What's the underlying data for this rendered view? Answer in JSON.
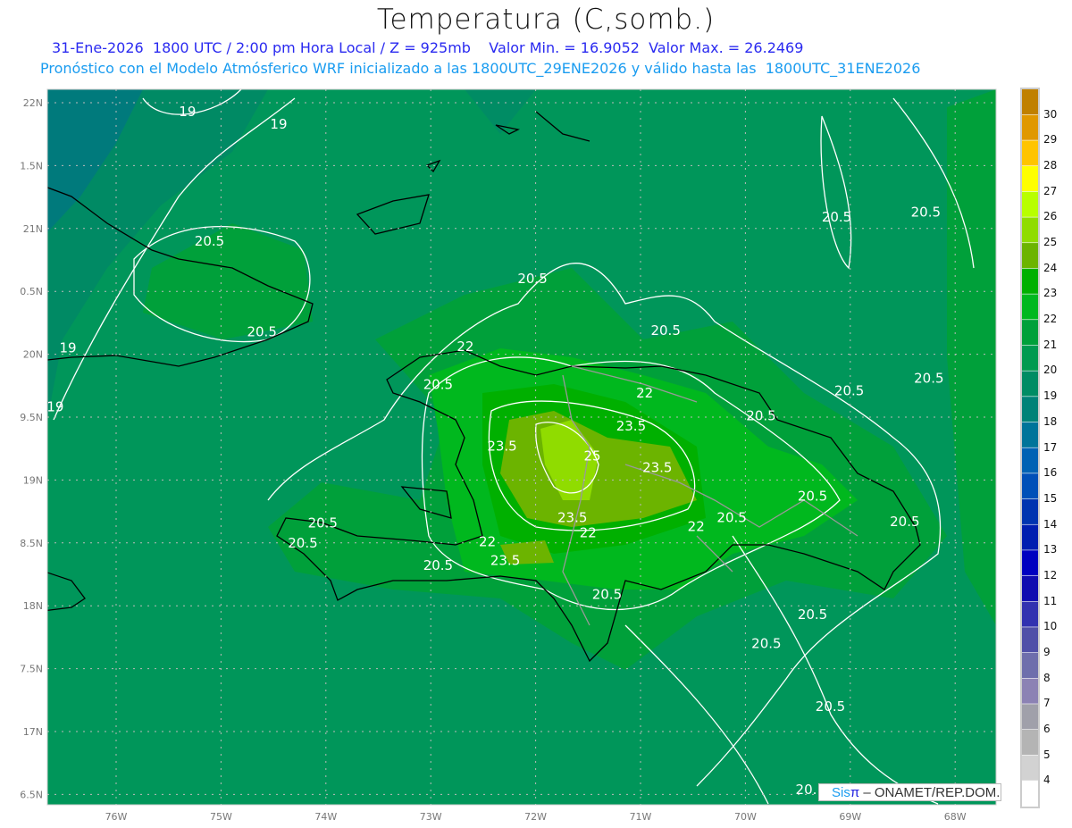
{
  "header": {
    "title": "Temperatura (C,somb.)",
    "subtitle_1": "31-Ene-2026  1800 UTC / 2:00 pm Hora Local / Z = 925mb    Valor Min. = 16.9052  Valor Max. = 26.2469",
    "subtitle_2": "Pronóstico con el Modelo Atmósferico WRF inicializado a las 1800UTC_29ENE2026 y válido hasta las  1800UTC_31ENE2026"
  },
  "map": {
    "projection": "lat-lon",
    "lon_range": [
      -76.65,
      -67.6
    ],
    "lat_range": [
      16.4,
      22.1
    ],
    "lon_ticks": [
      "76W",
      "75W",
      "74W",
      "73W",
      "72W",
      "71W",
      "70W",
      "69W",
      "68W"
    ],
    "lat_ticks": [
      "22N",
      "1.5N",
      "21N",
      "0.5N",
      "20N",
      "9.5N",
      "19N",
      "8.5N",
      "18N",
      "7.5N",
      "17N",
      "6.5N"
    ],
    "grid": "dashed",
    "contour_color": "#ffffff",
    "coastline_color": "#000000",
    "border_color": "#999999",
    "contour_labels": [
      {
        "text": "19",
        "lon": -75.32,
        "lat": 21.93
      },
      {
        "text": "19",
        "lon": -74.45,
        "lat": 21.83
      },
      {
        "text": "20.5",
        "lon": -75.11,
        "lat": 20.9
      },
      {
        "text": "20.5",
        "lon": -72.03,
        "lat": 20.6
      },
      {
        "text": "20.5",
        "lon": -74.61,
        "lat": 20.18
      },
      {
        "text": "19",
        "lon": -76.46,
        "lat": 20.05
      },
      {
        "text": "19",
        "lon": -76.58,
        "lat": 19.58
      },
      {
        "text": "22",
        "lon": -72.67,
        "lat": 20.06
      },
      {
        "text": "20.5",
        "lon": -72.93,
        "lat": 19.76
      },
      {
        "text": "22",
        "lon": -70.96,
        "lat": 19.69
      },
      {
        "text": "23.5",
        "lon": -71.09,
        "lat": 19.43
      },
      {
        "text": "20.5",
        "lon": -70.76,
        "lat": 20.19
      },
      {
        "text": "20.5",
        "lon": -69.01,
        "lat": 19.71
      },
      {
        "text": "20.5",
        "lon": -68.25,
        "lat": 19.81
      },
      {
        "text": "20.5",
        "lon": -68.28,
        "lat": 21.13
      },
      {
        "text": "20.5",
        "lon": -69.13,
        "lat": 21.09
      },
      {
        "text": "20.5",
        "lon": -69.85,
        "lat": 19.51
      },
      {
        "text": "23.5",
        "lon": -72.32,
        "lat": 19.27
      },
      {
        "text": "25",
        "lon": -71.46,
        "lat": 19.19
      },
      {
        "text": "23.5",
        "lon": -70.84,
        "lat": 19.1
      },
      {
        "text": "20.5",
        "lon": -69.36,
        "lat": 18.87
      },
      {
        "text": "20.5",
        "lon": -68.48,
        "lat": 18.67
      },
      {
        "text": "20.5",
        "lon": -74.03,
        "lat": 18.66
      },
      {
        "text": "20.5",
        "lon": -74.22,
        "lat": 18.5
      },
      {
        "text": "23.5",
        "lon": -71.65,
        "lat": 18.7
      },
      {
        "text": "22",
        "lon": -71.5,
        "lat": 18.58
      },
      {
        "text": "22",
        "lon": -70.47,
        "lat": 18.63
      },
      {
        "text": "20.5",
        "lon": -70.13,
        "lat": 18.7
      },
      {
        "text": "22",
        "lon": -72.46,
        "lat": 18.51
      },
      {
        "text": "23.5",
        "lon": -72.29,
        "lat": 18.36
      },
      {
        "text": "20.5",
        "lon": -72.93,
        "lat": 18.32
      },
      {
        "text": "20.5",
        "lon": -71.32,
        "lat": 18.09
      },
      {
        "text": "20.5",
        "lon": -69.36,
        "lat": 17.93
      },
      {
        "text": "20.5",
        "lon": -69.8,
        "lat": 17.7
      },
      {
        "text": "20.5",
        "lon": -69.19,
        "lat": 17.2
      },
      {
        "text": "20.",
        "lon": -69.42,
        "lat": 16.54
      }
    ]
  },
  "colorbar": {
    "labels": [
      "30",
      "29",
      "28",
      "27",
      "26",
      "25",
      "24",
      "23",
      "22",
      "21",
      "20",
      "19",
      "18",
      "17",
      "16",
      "15",
      "14",
      "13",
      "12",
      "11",
      "10",
      "9",
      "8",
      "7",
      "6",
      "5",
      "4"
    ],
    "colors": [
      "#c08000",
      "#e09800",
      "#ffc400",
      "#ffff00",
      "#b8ff00",
      "#90dc00",
      "#6cb400",
      "#00b000",
      "#00b81e",
      "#00a03a",
      "#009a50",
      "#008c64",
      "#008278",
      "#00749a",
      "#0062b4",
      "#0050b8",
      "#0034b0",
      "#001eb0",
      "#0000c0",
      "#100cb0",
      "#3232b0",
      "#5050a8",
      "#6e6eac",
      "#8c82b4",
      "#a0a0aa",
      "#b4b4b4",
      "#d2d2d2",
      "#ffffff"
    ]
  },
  "credit": {
    "sis": "Sis",
    "pi": "π",
    "rest": "– ONAMET/REP.DOM."
  }
}
